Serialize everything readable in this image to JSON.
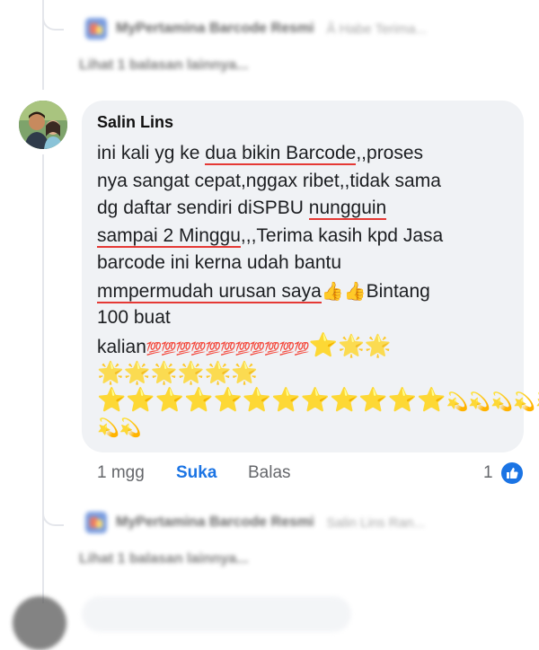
{
  "top_reply": {
    "page_name": "MyPertamina Barcode Resmi",
    "snippet": "Â Habe Terima...",
    "more_replies": "Lihat 1 balasan lainnya..."
  },
  "comment": {
    "author": "Salin Lins",
    "lines": [
      {
        "parts": [
          {
            "t": "ini kali yg ke "
          },
          {
            "t": "dua bikin Barcode",
            "u": true
          },
          {
            "t": ",,proses"
          }
        ]
      },
      {
        "parts": [
          {
            "t": "nya sangat cepat,nggax ribet,,tidak sama"
          }
        ]
      },
      {
        "parts": [
          {
            "t": "dg daftar sendiri diSPBU "
          },
          {
            "t": "nungguin",
            "u": true
          }
        ]
      },
      {
        "parts": [
          {
            "t": "sampai  2 Minggu",
            "u": true
          },
          {
            "t": ",,,Terima kasih kpd Jasa"
          }
        ]
      },
      {
        "parts": [
          {
            "t": "barcode ini kerna udah bantu"
          }
        ]
      },
      {
        "parts": [
          {
            "t": "mmpermudah urusan saya",
            "u": true
          },
          {
            "t": "👍👍",
            "e": "thumb"
          },
          {
            "t": "Bintang"
          }
        ]
      },
      {
        "parts": [
          {
            "t": "100 buat"
          }
        ]
      },
      {
        "parts": [
          {
            "t": "kalian"
          },
          {
            "t": "💯💯💯💯💯💯💯💯💯💯💯",
            "e": "hundred"
          },
          {
            "t": "⭐",
            "e": "star"
          },
          {
            "t": "🌟🌟",
            "e": "glow"
          }
        ]
      },
      {
        "parts": [
          {
            "t": "🌟🌟🌟🌟🌟🌟",
            "e": "glow"
          }
        ]
      },
      {
        "parts": [
          {
            "t": "⭐⭐⭐⭐⭐⭐⭐⭐⭐⭐⭐⭐",
            "e": "star"
          },
          {
            "t": "💫💫💫💫💫",
            "e": "sparkle"
          }
        ]
      },
      {
        "parts": [
          {
            "t": "💫💫",
            "e": "sparkle"
          }
        ]
      }
    ],
    "time": "1 mgg",
    "like_label": "Suka",
    "reply_label": "Balas",
    "reaction_count": "1",
    "reaction_icon": "like-icon"
  },
  "bottom_reply": {
    "page_name": "MyPertamina Barcode Resmi",
    "snippet": "Salin Lins Ran...",
    "more_replies": "Lihat 1 balasan lainnya..."
  },
  "colors": {
    "accent": "#1b74e4",
    "bubble": "#f0f2f5",
    "underline": "#e53935"
  }
}
